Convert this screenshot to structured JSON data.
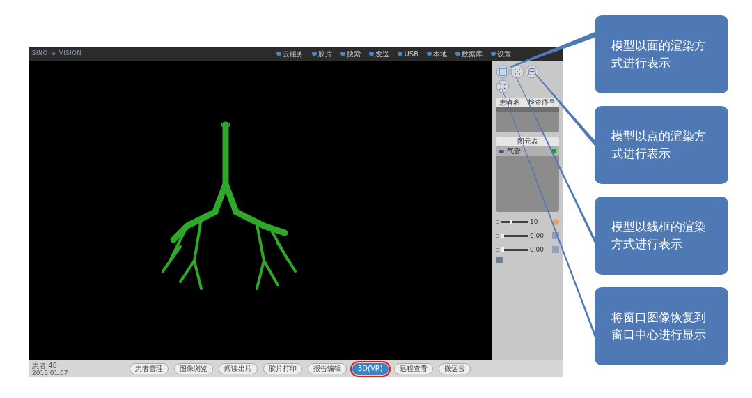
{
  "app": {
    "logo_left": "SINO",
    "logo_right": "VISION"
  },
  "nav": [
    {
      "label": "云服务"
    },
    {
      "label": "胶片"
    },
    {
      "label": "搜索"
    },
    {
      "label": "发送"
    },
    {
      "label": "USB"
    },
    {
      "label": "本地"
    },
    {
      "label": "数据库"
    },
    {
      "label": "设置"
    }
  ],
  "render_modes": [
    {
      "kind": "surface",
      "selected": true
    },
    {
      "kind": "points",
      "selected": false
    },
    {
      "kind": "wireframe",
      "selected": false
    },
    {
      "kind": "reset",
      "selected": false
    }
  ],
  "patient_table": {
    "columns": [
      "患者名",
      "检查序号"
    ]
  },
  "model_list": {
    "title": "图元表",
    "items": [
      {
        "name": "气管",
        "color": "#16a01c"
      }
    ]
  },
  "sliders": [
    {
      "kind": "opacity",
      "level": 0.35,
      "reading": "10"
    },
    {
      "kind": "smooth",
      "level": 0.03,
      "reading": "0.00"
    },
    {
      "kind": "shrink",
      "level": 0.03,
      "reading": "0.00"
    }
  ],
  "status": {
    "line_1": "患者 48",
    "line_2": "2016.01.07"
  },
  "bottom_tabs": [
    {
      "label": "患者管理",
      "selected": false
    },
    {
      "label": "图像浏览",
      "selected": false
    },
    {
      "label": "阅读出片",
      "selected": false
    },
    {
      "label": "胶片打印",
      "selected": false
    },
    {
      "label": "报告编辑",
      "selected": false
    },
    {
      "label": "3D(VR)",
      "selected": true
    },
    {
      "label": "远程查看",
      "selected": false
    },
    {
      "label": "微远云",
      "selected": false
    }
  ],
  "callouts": [
    {
      "text": "模型以面的渲染方式进行表示"
    },
    {
      "text": "模型以点的渲染方式进行表示"
    },
    {
      "text": "模型以线框的渲染方式进行表示"
    },
    {
      "text": "将窗口图像恢复到窗口中心进行显示"
    }
  ]
}
